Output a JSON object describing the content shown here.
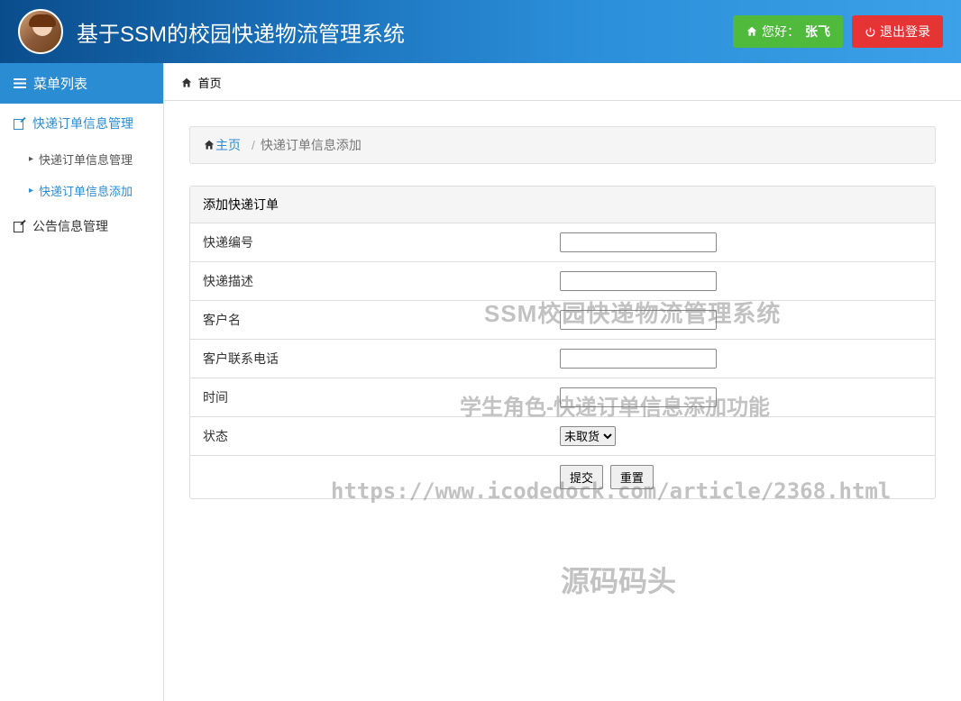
{
  "header": {
    "title": "基于SSM的校园快递物流管理系统",
    "greeting_prefix": "您好：",
    "username": "张飞",
    "logout_label": "退出登录"
  },
  "sidebar": {
    "title": "菜单列表",
    "items": [
      {
        "label": "快递订单信息管理",
        "active": true,
        "children": [
          {
            "label": "快递订单信息管理",
            "active": false
          },
          {
            "label": "快递订单信息添加",
            "active": true
          }
        ]
      },
      {
        "label": "公告信息管理",
        "active": false,
        "children": []
      }
    ]
  },
  "tabbar": {
    "home_label": "首页"
  },
  "breadcrumb": {
    "home": "主页",
    "current": "快递订单信息添加"
  },
  "form": {
    "panel_title": "添加快递订单",
    "fields": {
      "express_no": {
        "label": "快递编号",
        "value": ""
      },
      "description": {
        "label": "快递描述",
        "value": ""
      },
      "customer_name": {
        "label": "客户名",
        "value": ""
      },
      "customer_phone": {
        "label": "客户联系电话",
        "value": ""
      },
      "time": {
        "label": "时间",
        "value": ""
      },
      "status": {
        "label": "状态",
        "selected": "未取货",
        "options": [
          "未取货"
        ]
      }
    },
    "buttons": {
      "submit": "提交",
      "reset": "重置"
    }
  },
  "watermarks": {
    "line1": "SSM校园快递物流管理系统",
    "line2": "学生角色-快递订单信息添加功能",
    "line3": "https://www.icodedock.com/article/2368.html",
    "line4": "源码码头"
  }
}
